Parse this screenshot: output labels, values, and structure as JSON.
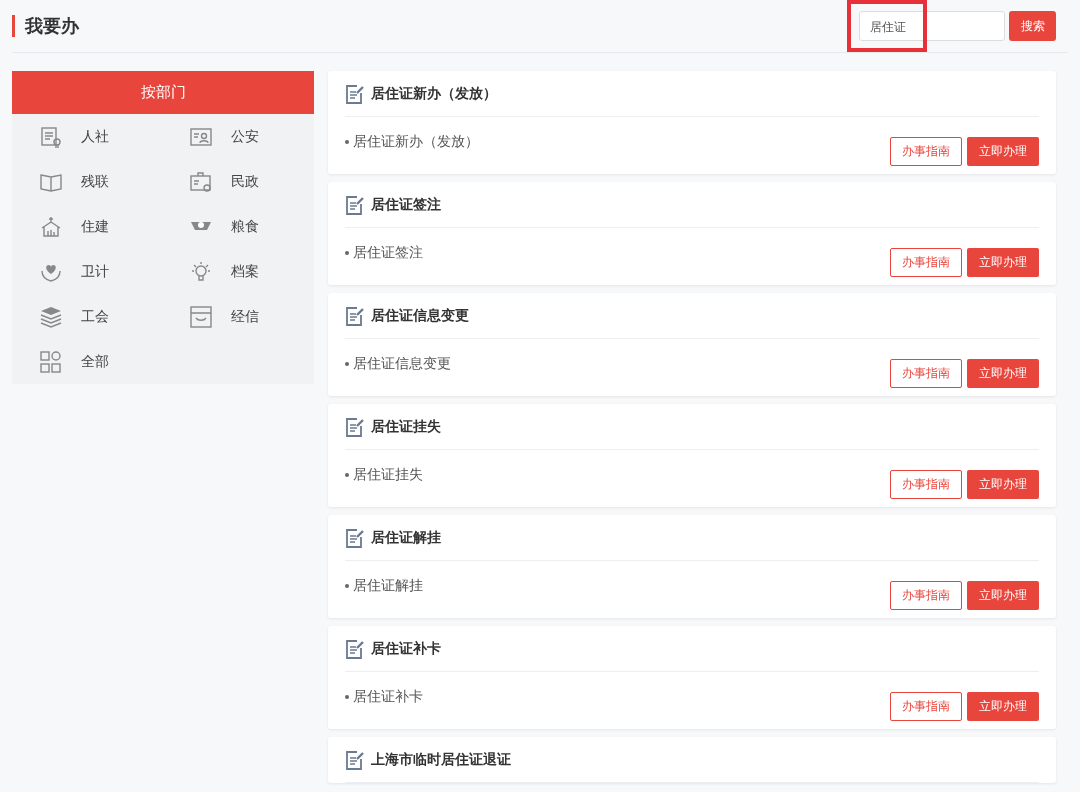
{
  "page_title": "我要办",
  "search": {
    "value": "居住证",
    "highlighted": true,
    "button": "搜索"
  },
  "sidebar": {
    "header": "按部门",
    "items": [
      {
        "label": "人社"
      },
      {
        "label": "公安"
      },
      {
        "label": "残联"
      },
      {
        "label": "民政"
      },
      {
        "label": "住建"
      },
      {
        "label": "粮食"
      },
      {
        "label": "卫计"
      },
      {
        "label": "档案"
      },
      {
        "label": "工会"
      },
      {
        "label": "经信"
      },
      {
        "label": "全部"
      }
    ]
  },
  "services": [
    {
      "title": "居住证新办（发放）",
      "item": "居住证新办（发放）",
      "buttons": [
        "办事指南",
        "立即办理"
      ]
    },
    {
      "title": "居住证签注",
      "item": "居住证签注",
      "buttons": [
        "办事指南",
        "立即办理"
      ]
    },
    {
      "title": "居住证信息变更",
      "item": "居住证信息变更",
      "buttons": [
        "办事指南",
        "立即办理"
      ]
    },
    {
      "title": "居住证挂失",
      "item": "居住证挂失",
      "buttons": [
        "办事指南",
        "立即办理"
      ]
    },
    {
      "title": "居住证解挂",
      "item": "居住证解挂",
      "buttons": [
        "办事指南",
        "立即办理"
      ]
    },
    {
      "title": "居住证补卡",
      "item": "居住证补卡",
      "buttons": [
        "办事指南",
        "立即办理"
      ]
    },
    {
      "title": "上海市临时居住证退证"
    }
  ]
}
